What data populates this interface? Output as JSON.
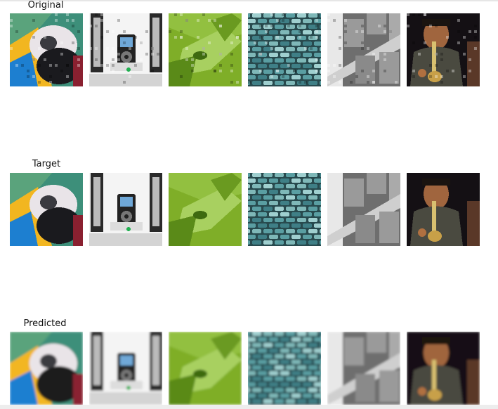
{
  "rows": [
    {
      "label": "Original",
      "images": [
        "parrot",
        "ipod-dock",
        "green-leaf",
        "blue-pebbles",
        "grey-building",
        "saxophone-player"
      ]
    },
    {
      "label": "Target",
      "images": [
        "parrot",
        "ipod-dock",
        "green-leaf",
        "blue-pebbles",
        "grey-building",
        "saxophone-player"
      ]
    },
    {
      "label": "Predicted",
      "images": [
        "parrot",
        "ipod-dock",
        "green-leaf",
        "blue-pebbles",
        "grey-building",
        "saxophone-player"
      ]
    }
  ]
}
